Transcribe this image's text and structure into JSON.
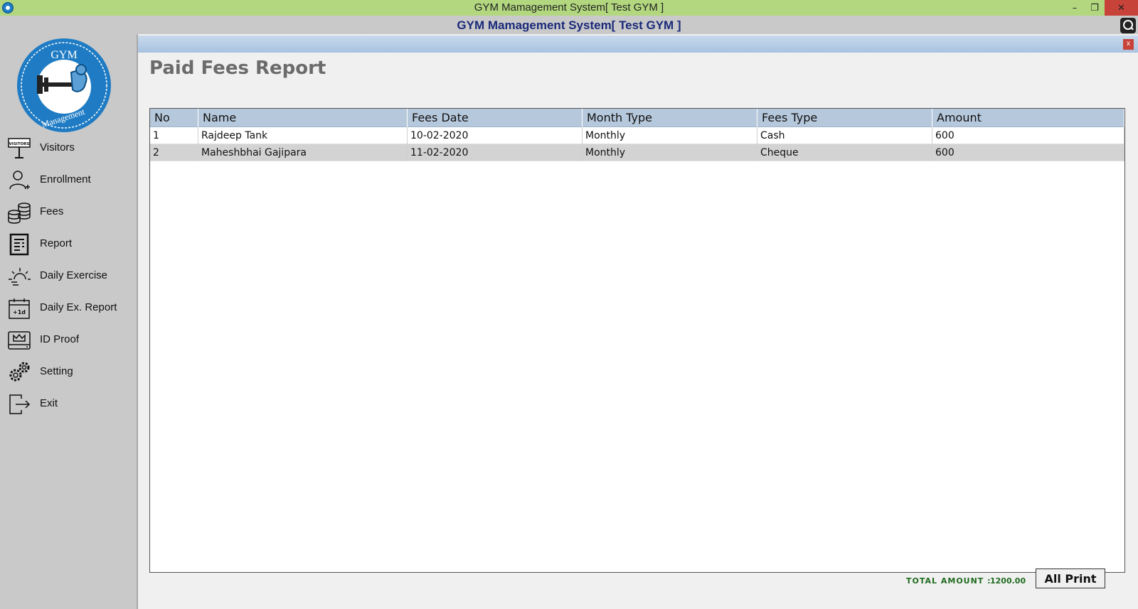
{
  "window": {
    "title": "GYM Mamagement System[ Test GYM ]",
    "minimize_glyph": "–",
    "maximize_glyph": "❐",
    "close_glyph": "✕"
  },
  "header": {
    "title": "GYM Mamagement System[ Test GYM ]"
  },
  "logo": {
    "top_text": "GYM",
    "bottom_text": "Management"
  },
  "sidebar": {
    "items": [
      {
        "label": "Visitors",
        "icon": "visitors-sign-icon",
        "icon_text": "VISITORS"
      },
      {
        "label": "Enrollment",
        "icon": "user-add-icon"
      },
      {
        "label": "Fees",
        "icon": "coins-stack-icon"
      },
      {
        "label": "Report",
        "icon": "report-document-icon"
      },
      {
        "label": "Daily Exercise",
        "icon": "sunrise-icon"
      },
      {
        "label": "Daily Ex. Report",
        "icon": "calendar-icon",
        "icon_text": "+1d"
      },
      {
        "label": "ID Proof",
        "icon": "id-card-icon"
      },
      {
        "label": "Setting",
        "icon": "gears-icon"
      },
      {
        "label": "Exit",
        "icon": "exit-icon"
      }
    ]
  },
  "panel": {
    "close_glyph": "x",
    "title": "Paid Fees Report"
  },
  "table": {
    "columns": [
      "No",
      "Name",
      "Fees Date",
      "Month Type",
      "Fees Type",
      "Amount"
    ],
    "rows": [
      [
        "1",
        "Rajdeep Tank",
        "10-02-2020",
        "Monthly",
        "Cash",
        "600"
      ],
      [
        "2",
        "Maheshbhai Gajipara",
        "11-02-2020",
        "Monthly",
        "Cheque",
        "600"
      ]
    ]
  },
  "footer": {
    "total_label": "TOTAL AMOUNT :",
    "total_value": "1200.00",
    "print_button": "All Print"
  },
  "colors": {
    "titlebar": "#b2d77f",
    "header_title": "#1a2a7a",
    "grid_header": "#b6c8dc",
    "total_text": "#1f6b1f",
    "logo_blue": "#1f7cc4"
  }
}
